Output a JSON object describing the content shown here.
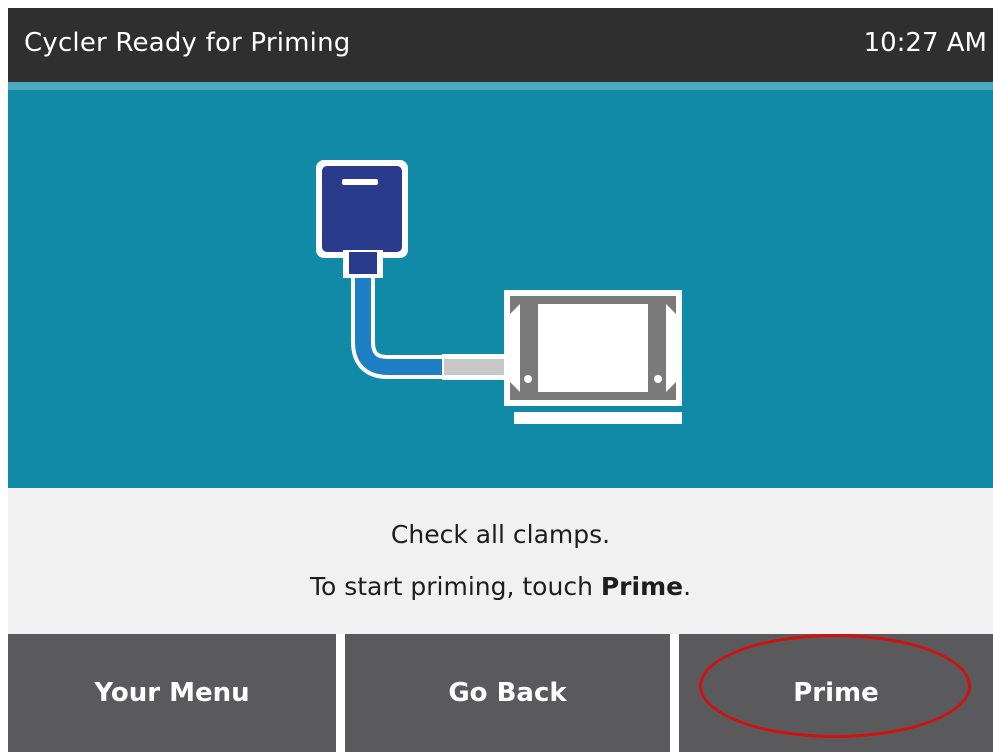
{
  "header": {
    "title": "Cycler Ready for Priming",
    "time": "10:27 AM"
  },
  "illustration": {
    "icon": "cassette-connected-to-cycler-icon",
    "colors": {
      "background": "#118aa8",
      "bag": "#2a3a8c",
      "tubing": "#1e7fc4",
      "connector": "#c8c8c8",
      "cycler": "#7a7a7a"
    }
  },
  "instructions": {
    "line1": "Check all clamps.",
    "line2_prefix": "To start priming, touch ",
    "line2_bold": "Prime",
    "line2_suffix": "."
  },
  "buttons": {
    "your_menu": "Your Menu",
    "go_back": "Go Back",
    "prime": "Prime"
  },
  "annotation": {
    "highlight_color": "#d40f0f",
    "highlighted_button": "Prime"
  }
}
